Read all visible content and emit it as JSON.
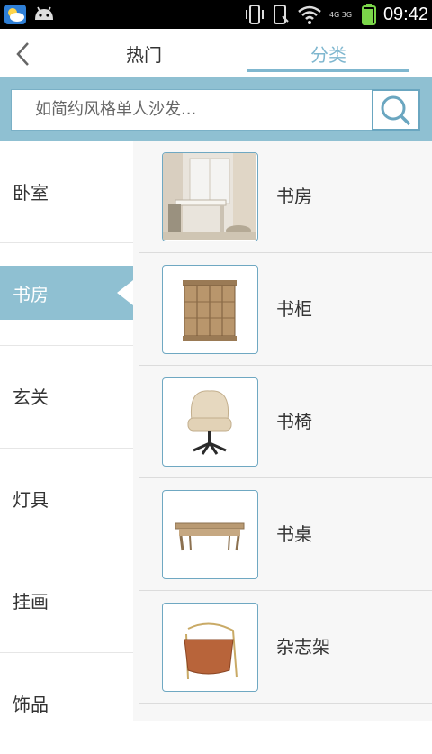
{
  "status_bar": {
    "time": "09:42",
    "network": "4G 3G",
    "icons": [
      "weather-icon",
      "android-icon",
      "vibrate-icon",
      "phone-icon",
      "wifi-icon",
      "signal-icon",
      "battery-icon"
    ]
  },
  "header": {
    "back_icon": "chevron-left-icon",
    "tabs": [
      {
        "label": "热门",
        "active": false
      },
      {
        "label": "分类",
        "active": true
      }
    ]
  },
  "search": {
    "placeholder": "如简约风格单人沙发...",
    "button_icon": "search-icon"
  },
  "sidebar": {
    "items": [
      {
        "label": "卧室",
        "active": false
      },
      {
        "label": "书房",
        "active": true
      },
      {
        "label": "玄关",
        "active": false
      },
      {
        "label": "灯具",
        "active": false
      },
      {
        "label": "挂画",
        "active": false
      },
      {
        "label": "饰品",
        "active": false
      }
    ]
  },
  "subcategories": [
    {
      "label": "书房",
      "image": "study-room-photo"
    },
    {
      "label": "书柜",
      "image": "bookcase-photo"
    },
    {
      "label": "书椅",
      "image": "desk-chair-photo"
    },
    {
      "label": "书桌",
      "image": "writing-desk-photo"
    },
    {
      "label": "杂志架",
      "image": "magazine-rack-photo"
    }
  ],
  "colors": {
    "accent": "#8fc0d2",
    "tab_active": "#7fb7cf",
    "status_bar": "#000000"
  }
}
